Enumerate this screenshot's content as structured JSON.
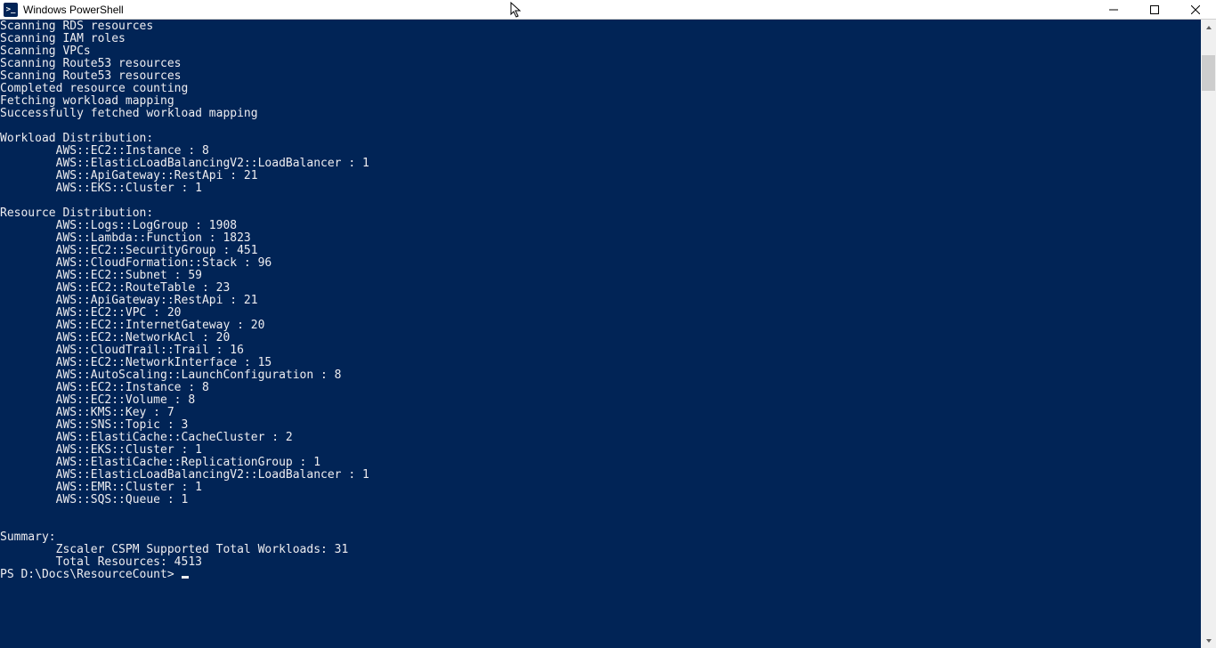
{
  "window": {
    "title": "Windows PowerShell",
    "icon_label": ">_"
  },
  "terminal": {
    "scan_lines": [
      "Scanning RDS resources",
      "Scanning IAM roles",
      "Scanning VPCs",
      "Scanning Route53 resources",
      "Scanning Route53 resources",
      "Completed resource counting",
      "Fetching workload mapping",
      "Successfully fetched workload mapping"
    ],
    "workload_header": "Workload Distribution:",
    "workload_items": [
      "        AWS::EC2::Instance : 8",
      "        AWS::ElasticLoadBalancingV2::LoadBalancer : 1",
      "        AWS::ApiGateway::RestApi : 21",
      "        AWS::EKS::Cluster : 1"
    ],
    "resource_header": "Resource Distribution:",
    "resource_items": [
      "        AWS::Logs::LogGroup : 1908",
      "        AWS::Lambda::Function : 1823",
      "        AWS::EC2::SecurityGroup : 451",
      "        AWS::CloudFormation::Stack : 96",
      "        AWS::EC2::Subnet : 59",
      "        AWS::EC2::RouteTable : 23",
      "        AWS::ApiGateway::RestApi : 21",
      "        AWS::EC2::VPC : 20",
      "        AWS::EC2::InternetGateway : 20",
      "        AWS::EC2::NetworkAcl : 20",
      "        AWS::CloudTrail::Trail : 16",
      "        AWS::EC2::NetworkInterface : 15",
      "        AWS::AutoScaling::LaunchConfiguration : 8",
      "        AWS::EC2::Instance : 8",
      "        AWS::EC2::Volume : 8",
      "        AWS::KMS::Key : 7",
      "        AWS::SNS::Topic : 3",
      "        AWS::ElastiCache::CacheCluster : 2",
      "        AWS::EKS::Cluster : 1",
      "        AWS::ElastiCache::ReplicationGroup : 1",
      "        AWS::ElasticLoadBalancingV2::LoadBalancer : 1",
      "        AWS::EMR::Cluster : 1",
      "        AWS::SQS::Queue : 1"
    ],
    "summary_header": "Summary:",
    "summary_items": [
      "        Zscaler CSPM Supported Total Workloads: 31",
      "        Total Resources: 4513"
    ],
    "prompt": "PS D:\\Docs\\ResourceCount> "
  }
}
